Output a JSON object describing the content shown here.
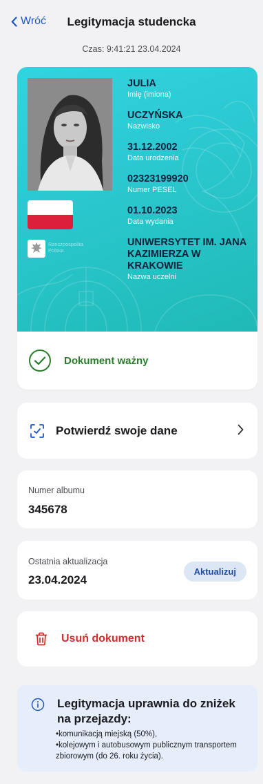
{
  "header": {
    "back_label": "Wróć",
    "title": "Legitymacja studencka"
  },
  "timestamp": "Czas: 9:41:21 23.04.2024",
  "id_card": {
    "fields": [
      {
        "value": "JULIA",
        "label": "Imię (imiona)"
      },
      {
        "value": "UCZYŃSKA",
        "label": "Nazwisko"
      },
      {
        "value": "31.12.2002",
        "label": "Data urodzenia"
      },
      {
        "value": "02323199920",
        "label": "Numer PESEL"
      },
      {
        "value": "01.10.2023",
        "label": "Data wydania"
      },
      {
        "value": "UNIWERSYTET IM. JANA KAZIMIERZA W KRAKOWIE",
        "label": "Nazwa uczelni"
      }
    ],
    "emblem_text": "Rzeczpospolita Polska",
    "status": "Dokument ważny"
  },
  "confirm": {
    "label": "Potwierdź swoje dane"
  },
  "album": {
    "label": "Numer albumu",
    "value": "345678"
  },
  "update": {
    "label": "Ostatnia aktualizacja",
    "value": "23.04.2024",
    "button": "Aktualizuj"
  },
  "delete": {
    "label": "Usuń dokument"
  },
  "info": {
    "title": "Legitymacja uprawnia do zniżek na przejazdy:",
    "items": [
      "•komunikacją miejską (50%),",
      "•kolejowym i autobusowym publicznym transportem zbiorowym (do 26. roku życia)."
    ]
  },
  "colors": {
    "accent": "#1e56c6",
    "card_teal": "#2ac7cf",
    "valid_green": "#2a7d2a",
    "delete_red": "#d42b2b",
    "info_bg": "#e5eefa"
  }
}
